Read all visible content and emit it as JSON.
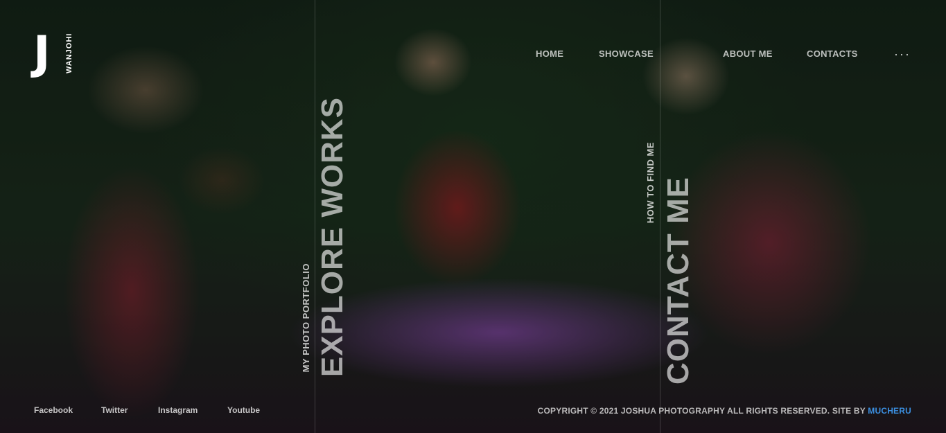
{
  "logo": {
    "letter": "J",
    "name": "WANJOHI"
  },
  "nav": {
    "items": [
      {
        "label": "HOME"
      },
      {
        "label": "SHOWCASE"
      },
      {
        "label": "ABOUT ME"
      },
      {
        "label": "CONTACTS"
      }
    ],
    "more_icon": "more-dots-icon",
    "more_glyph": "···"
  },
  "sections": {
    "explore": {
      "subtitle": "MY PHOTO PORTFOLIO",
      "title": "EXPLORE WORKS"
    },
    "contact": {
      "subtitle": "HOW TO FIND ME",
      "title": "CONTACT ME"
    }
  },
  "footer": {
    "social": [
      "Facebook",
      "Twitter",
      "Instagram",
      "Youtube"
    ],
    "copyright": "COPYRIGHT © 2021 JOSHUA PHOTOGRAPHY ALL RIGHTS RESERVED. SITE BY",
    "credit": "MUCHERU"
  },
  "colors": {
    "credit": "#3b8fe0",
    "text": "#ffffff"
  }
}
